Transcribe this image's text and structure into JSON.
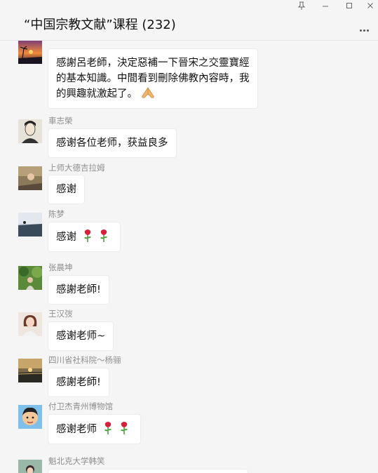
{
  "window": {
    "title": "“中国宗教文献”课程 (232)",
    "controls": [
      "pin-icon",
      "minimize-icon",
      "maximize-icon",
      "close-icon"
    ],
    "more_icon": "more-icon"
  },
  "colors": {
    "background": "#f5f5f5",
    "bubble": "#ffffff",
    "sender": "#8e8e8e"
  },
  "messages": [
    {
      "sender": "",
      "lines": [
        "感謝呂老師，決定惡補一下晉宋之交靈寶經",
        "的基本知識。中間看到刪除佛教內容時，我",
        "的興趣就激起了。"
      ],
      "emoji": [
        "pray-hands-icon"
      ]
    },
    {
      "sender": "車志榮",
      "lines": [
        "感谢各位老师，获益良多"
      ],
      "emoji": []
    },
    {
      "sender": "上师大德吉拉姆",
      "lines": [
        "感谢"
      ],
      "emoji": []
    },
    {
      "sender": "陈梦",
      "lines": [
        "感谢"
      ],
      "emoji": [
        "rose-icon",
        "rose-icon"
      ]
    },
    {
      "sender": "张晨坤",
      "lines": [
        "感謝老師!"
      ],
      "emoji": []
    },
    {
      "sender": "王汉弢",
      "lines": [
        "感谢老师~"
      ],
      "emoji": []
    },
    {
      "sender": "四川省社科院～杨骊",
      "lines": [
        "感謝老師!"
      ],
      "emoji": []
    },
    {
      "sender": "付卫杰青州博物馆",
      "lines": [
        "感谢老师"
      ],
      "emoji": [
        "rose-icon",
        "rose-icon"
      ]
    },
    {
      "sender": "魁北克大学韩笑",
      "lines": [],
      "emoji": []
    }
  ]
}
